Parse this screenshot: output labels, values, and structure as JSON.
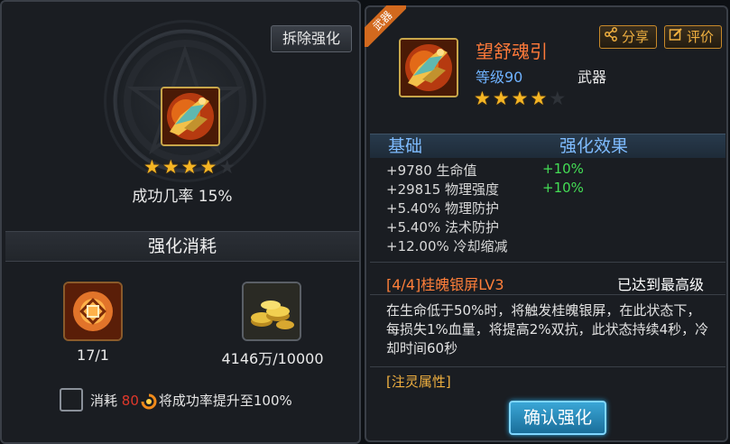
{
  "left_panel": {
    "remove_button": "拆除强化",
    "item_stars": {
      "filled": 4,
      "total": 5
    },
    "success_rate": "成功几率 15%",
    "section_title": "强化消耗",
    "materials": [
      {
        "icon": "rune-stone-icon",
        "count": "17/1"
      },
      {
        "icon": "gold-coins-icon",
        "count": "4146万/10000"
      }
    ],
    "consume": {
      "prefix": "消耗",
      "amount": "80",
      "suffix": "将成功率提升至100%"
    }
  },
  "right_panel": {
    "badge": "武器",
    "item": {
      "name": "望舒魂引",
      "level": "等级90",
      "type": "武器",
      "stars": {
        "filled": 4,
        "total": 5
      }
    },
    "share_button": "分享",
    "review_button": "评价",
    "stats_header": {
      "base": "基础",
      "bonus": "强化效果"
    },
    "stats": [
      {
        "base": "+9780 生命值",
        "bonus": "+10%"
      },
      {
        "base": "+29815 物理强度",
        "bonus": "+10%"
      },
      {
        "base": "+5.40% 物理防护",
        "bonus": ""
      },
      {
        "base": "+5.40% 法术防护",
        "bonus": ""
      },
      {
        "base": "+12.00% 冷却缩减",
        "bonus": ""
      }
    ],
    "skill": {
      "title": "[4/4]桂魄银屏LV3",
      "status": "已达到最高级",
      "description": "在生命低于50%时，将触发桂魄银屏，在此状态下，每损失1%血量，将提高2%双抗，此状态持续4秒，冷却时间60秒"
    },
    "attribute_label": "[注灵属性]",
    "confirm_button": "确认强化"
  },
  "colors": {
    "star": "#f5b524",
    "item_name": "#ff7a3a",
    "level": "#6fb2ff",
    "bonus": "#44dd55",
    "header": "#7fbcff",
    "accent_button": "#c8892a",
    "confirm": "#2a8fc0"
  }
}
